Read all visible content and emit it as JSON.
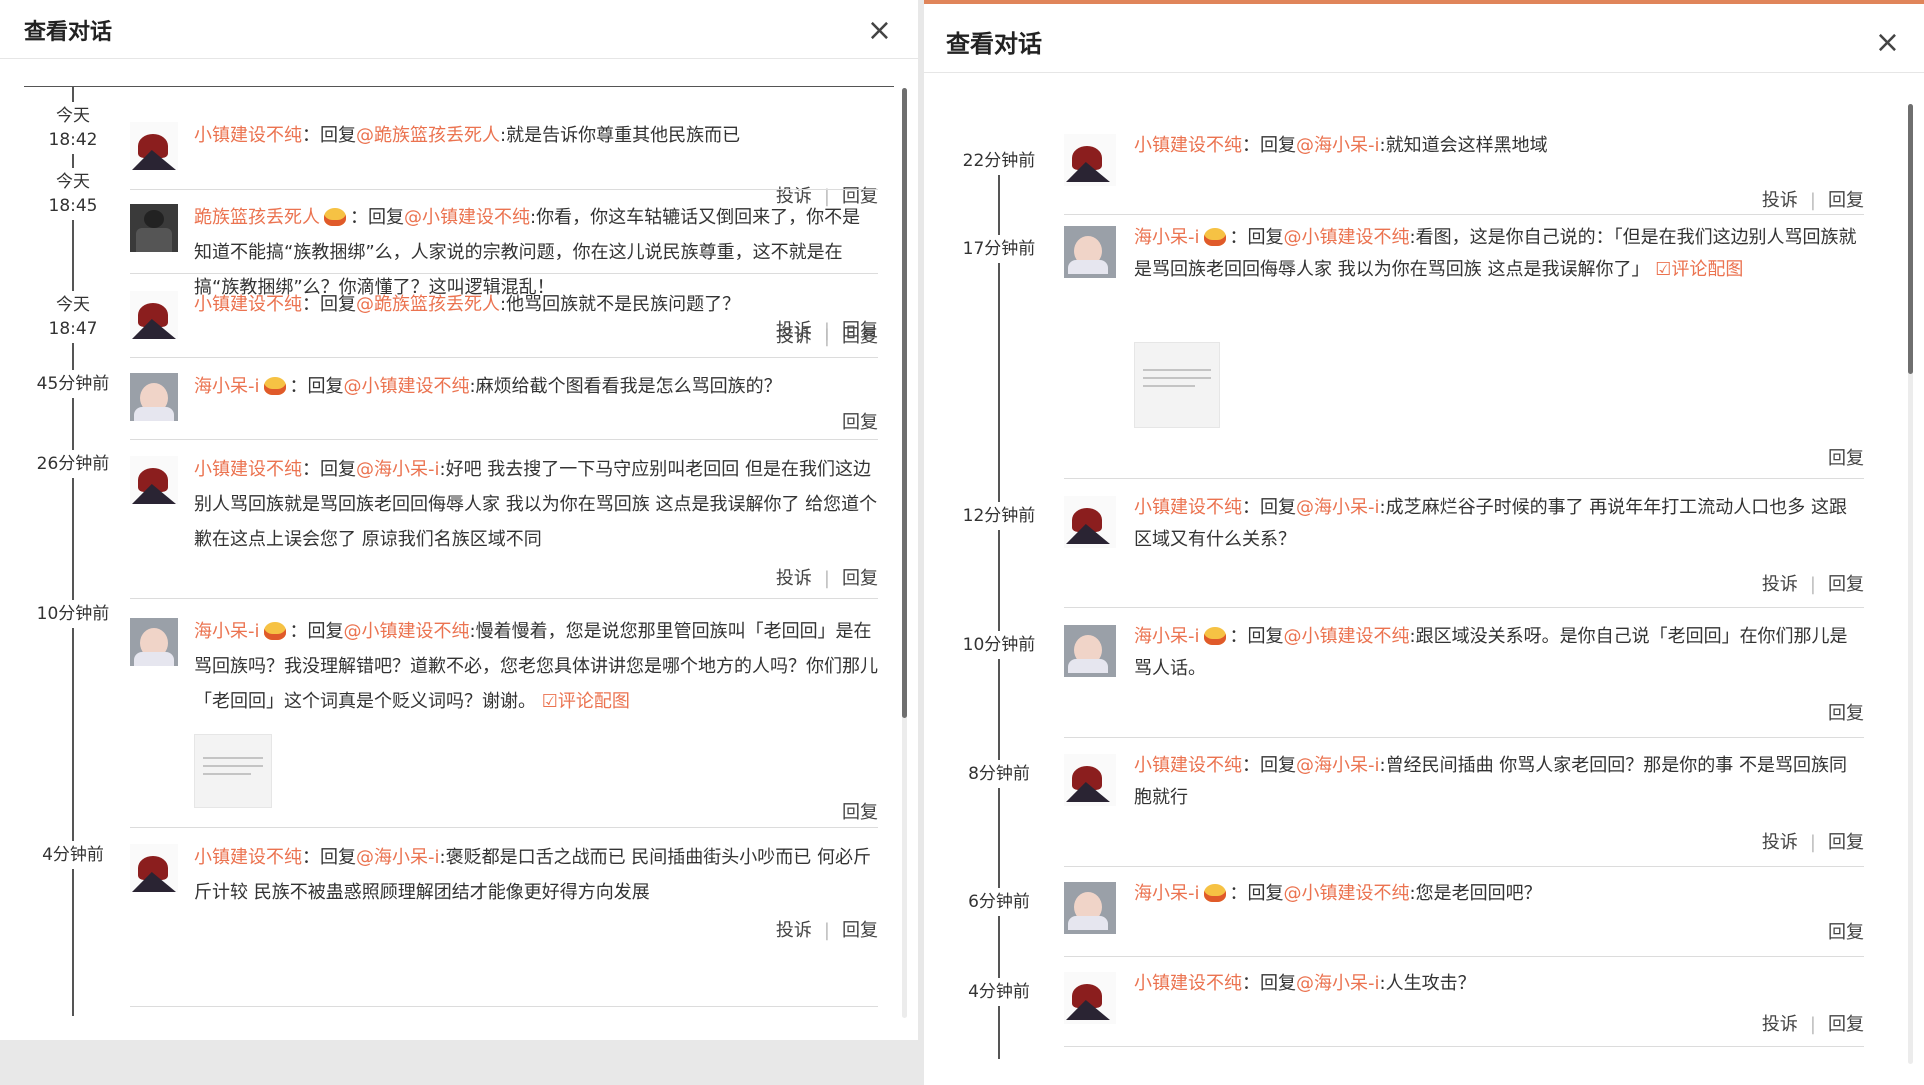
{
  "left": {
    "title": "查看对话",
    "close": "×",
    "entries": [
      {
        "time": [
          "今天",
          "18:42"
        ],
        "user": "小镇建设不纯",
        "reply_to": "@跪族篮孩丢死人",
        "text": ":就是告诉你尊重其他民族而已",
        "report": "投诉",
        "reply": "回复"
      },
      {
        "time": [
          "今天",
          "18:45"
        ],
        "user": "跪族篮孩丢死人",
        "reply_to": "@小镇建设不纯",
        "text": ":你看，你这车轱辘话又倒回来了，你不是知道不能搞“族教捆绑”么，人家说的宗教问题，你在这儿说民族尊重，这不就是在搞“族教捆绑”么？你滴懂了？这叫逻辑混乱！",
        "report": "投诉",
        "reply": "回复"
      },
      {
        "time": [
          "今天",
          "18:47"
        ],
        "user": "小镇建设不纯",
        "reply_to": "@跪族篮孩丢死人",
        "text": ":他骂回族就不是民族问题了？",
        "report": "投诉",
        "reply": "回复"
      },
      {
        "time": [
          "45分钟前"
        ],
        "user": "海小呆-i",
        "reply_to": "@小镇建设不纯",
        "text": ":麻烦给截个图看看我是怎么骂回族的？",
        "reply": "回复"
      },
      {
        "time": [
          "26分钟前"
        ],
        "user": "小镇建设不纯",
        "reply_to": "@海小呆-i",
        "text": ":好吧  我去搜了一下马守应别叫老回回  但是在我们这边别人骂回族就是骂回族老回回侮辱人家  我以为你在骂回族   这点是我误解你了  给您道个歉在这点上误会您了 原谅我们名族区域不同",
        "report": "投诉",
        "reply": "回复"
      },
      {
        "time": [
          "10分钟前"
        ],
        "user": "海小呆-i",
        "reply_to": "@小镇建设不纯",
        "text": ":慢着慢着，您是说您那里管回族叫「老回回」是在骂回族吗？我没理解错吧？道歉不必，您老您具体讲讲您是哪个地方的人吗？你们那儿「老回回」这个词真是个贬义词吗？谢谢。",
        "link": "☑评论配图",
        "reply": "回复"
      },
      {
        "time": [
          "4分钟前"
        ],
        "user": "小镇建设不纯",
        "reply_to": "@海小呆-i",
        "text": ":褒贬都是口舌之战而已   民间插曲街头小吵而已  何必斤斤计较   民族不被蛊惑照顾理解团结才能像更好得方向发展",
        "report": "投诉",
        "reply": "回复"
      }
    ]
  },
  "right": {
    "title": "查看对话",
    "close": "×",
    "entries": [
      {
        "time": [
          "22分钟前"
        ],
        "user": "小镇建设不纯",
        "reply_to": "@海小呆-i",
        "text": ":就知道会这样黑地域",
        "report": "投诉",
        "reply": "回复"
      },
      {
        "time": [
          "17分钟前"
        ],
        "user": "海小呆-i",
        "reply_to": "@小镇建设不纯",
        "text": ":看图，这是你自己说的：「但是在我们这边别人骂回族就是骂回族老回回侮辱人家  我以为你在骂回族   这点是我误解你了」",
        "link": "☑评论配图",
        "reply": "回复"
      },
      {
        "time": [
          "12分钟前"
        ],
        "user": "小镇建设不纯",
        "reply_to": "@海小呆-i",
        "text": ":成芝麻烂谷子时候的事了  再说年年打工流动人口也多   这跟区域又有什么关系？",
        "report": "投诉",
        "reply": "回复"
      },
      {
        "time": [
          "10分钟前"
        ],
        "user": "海小呆-i",
        "reply_to": "@小镇建设不纯",
        "text": ":跟区域没关系呀。是你自己说「老回回」在你们那儿是骂人话。",
        "reply": "回复"
      },
      {
        "time": [
          "8分钟前"
        ],
        "user": "小镇建设不纯",
        "reply_to": "@海小呆-i",
        "text": ":曾经民间插曲      你骂人家老回回？那是你的事  不是骂回族同胞就行",
        "report": "投诉",
        "reply": "回复"
      },
      {
        "time": [
          "6分钟前"
        ],
        "user": "海小呆-i",
        "reply_to": "@小镇建设不纯",
        "text": ":您是老回回吧？",
        "reply": "回复"
      },
      {
        "time": [
          "4分钟前"
        ],
        "user": "小镇建设不纯",
        "reply_to": "@海小呆-i",
        "text": ":人生攻击？",
        "report": "投诉",
        "reply": "回复"
      }
    ]
  },
  "reply_prefix": "回复",
  "colon": "：",
  "badge_icon": "vip-badge-icon",
  "colors": {
    "accent": "#eb7350",
    "panel_top_border": "#e0855a"
  }
}
